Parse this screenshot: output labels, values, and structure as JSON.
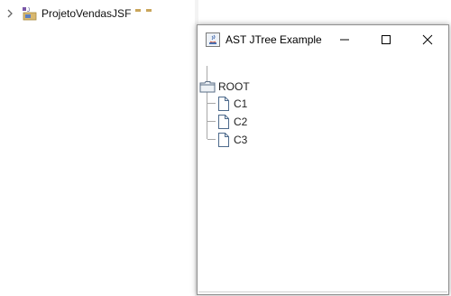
{
  "explorer": {
    "project_name": "ProjetoVendasJSF",
    "project_icon": "java-project-icon",
    "expand_icon": "chevron-right-icon"
  },
  "window": {
    "title": "AST JTree Example",
    "app_icon": "java-app-icon",
    "controls": [
      "minimize-icon",
      "maximize-icon",
      "close-icon"
    ]
  },
  "tree": {
    "root": {
      "label": "ROOT",
      "icon": "folder-icon"
    },
    "children": [
      {
        "label": "C1",
        "icon": "file-icon"
      },
      {
        "label": "C2",
        "icon": "file-icon"
      },
      {
        "label": "C3",
        "icon": "file-icon"
      }
    ]
  }
}
